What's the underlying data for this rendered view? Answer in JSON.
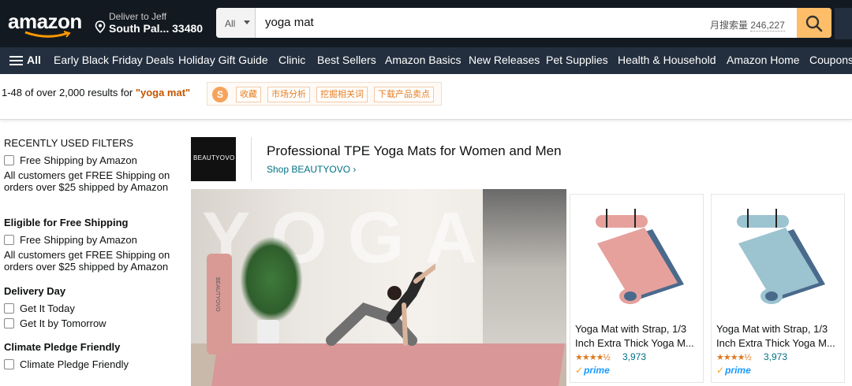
{
  "header": {
    "logo_text": "amazon",
    "deliver_line1": "Deliver to Jeff",
    "deliver_line2": "South Pal... 33480",
    "search_category": "All",
    "search_query": "yoga mat",
    "search_volume_label": "月搜索量",
    "search_volume_value": "246,227"
  },
  "nav": {
    "all_label": "All",
    "items": [
      "Early Black Friday Deals",
      "Holiday Gift Guide",
      "Clinic",
      "Best Sellers",
      "Amazon Basics",
      "New Releases",
      "Pet Supplies",
      "Health & Household",
      "Amazon Home",
      "Coupons"
    ]
  },
  "results": {
    "count_prefix": "1-48 of over 2,000 results for ",
    "keyword": "\"yoga mat\""
  },
  "plugin": {
    "icon_text": "S",
    "tags": [
      "收藏",
      "市场分析",
      "挖掘相关词",
      "下载产品卖点"
    ]
  },
  "sidebar": {
    "recent_heading": "RECENTLY USED FILTERS",
    "recent_checkbox": "Free Shipping by Amazon",
    "recent_note": "All customers get FREE Shipping on orders over $25 shipped by Amazon",
    "eligible_heading": "Eligible for Free Shipping",
    "eligible_checkbox": "Free Shipping by Amazon",
    "eligible_note": "All customers get FREE Shipping on orders over $25 shipped by Amazon",
    "delivery_heading": "Delivery Day",
    "delivery_options": [
      "Get It Today",
      "Get It by Tomorrow"
    ],
    "climate_heading": "Climate Pledge Friendly",
    "climate_checkbox": "Climate Pledge Friendly"
  },
  "brand": {
    "logo_text": "BEAUTYOVO",
    "title": "Professional TPE Yoga Mats for Women and Men",
    "shop_link": "Shop BEAUTYOVO ›",
    "hero_word": "YOGA",
    "roll_label": "BEAUTYOVO"
  },
  "products": [
    {
      "title_line1": "Yoga Mat with Strap, 1/3",
      "title_line2": "Inch Extra Thick Yoga M...",
      "stars": "★★★★½",
      "rating_count": "3,973",
      "prime": "prime",
      "color": "#e8a3a0"
    },
    {
      "title_line1": "Yoga Mat with Strap, 1/3",
      "title_line2": "Inch Extra Thick Yoga M...",
      "stars": "★★★★½",
      "rating_count": "3,973",
      "prime": "prime",
      "color": "#9dc3cf"
    }
  ],
  "colors": {
    "header_bg": "#131921",
    "nav_bg": "#232f3e",
    "search_button": "#febd69",
    "keyword": "#c45500",
    "link": "#007185",
    "star": "#de7921"
  }
}
